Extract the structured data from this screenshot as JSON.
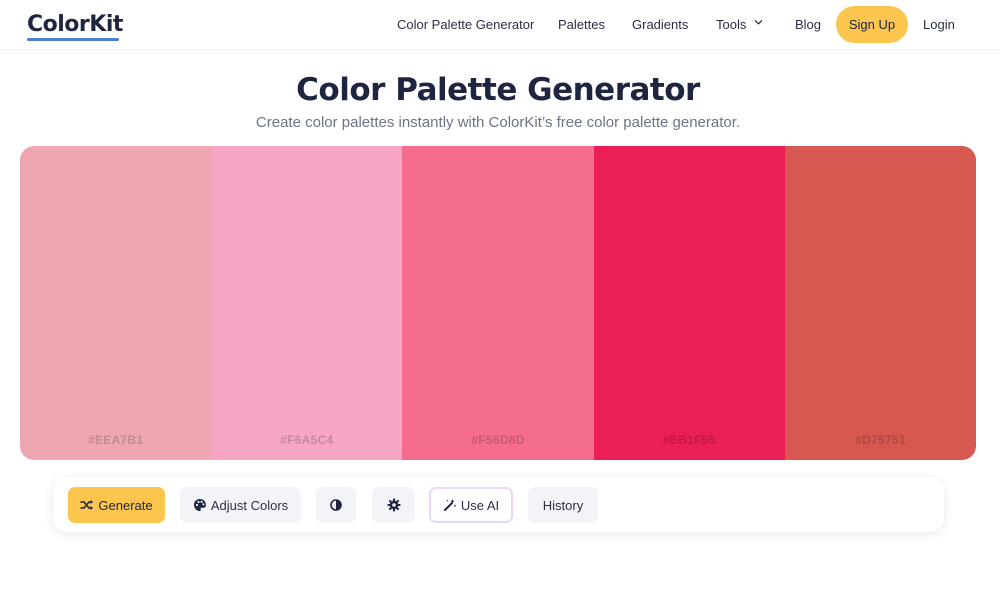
{
  "header": {
    "logo": "ColorKit",
    "nav": [
      {
        "label": "Color Palette Generator"
      },
      {
        "label": "Palettes"
      },
      {
        "label": "Gradients"
      },
      {
        "label": "Tools",
        "icon": "chevron-down-icon"
      },
      {
        "label": "Blog"
      }
    ],
    "signup_label": "Sign Up",
    "login_label": "Login"
  },
  "main": {
    "title": "Color Palette Generator",
    "subtitle": "Create color palettes instantly with ColorKit’s free color palette generator."
  },
  "palette": {
    "swatches": [
      {
        "hex": "#EEA7B1",
        "color": "#EEA7B1"
      },
      {
        "hex": "#F6A5C4",
        "color": "#F6A5C4"
      },
      {
        "hex": "#F56D8D",
        "color": "#F56D8D"
      },
      {
        "hex": "#EB1F55",
        "color": "#EB1F55"
      },
      {
        "hex": "#D75751",
        "color": "#D75751"
      }
    ]
  },
  "toolbar": {
    "generate_label": "Generate",
    "generate_icon": "shuffle-icon",
    "adjust_label": "Adjust Colors",
    "adjust_icon": "palette-icon",
    "contrast_icon": "contrast-icon",
    "settings_icon": "gear-icon",
    "ai_label": "Use AI",
    "ai_icon": "magic-wand-icon",
    "history_label": "History"
  },
  "colors": {
    "accent": "#FCC54E",
    "text_dark": "#1F2440",
    "logo_underline": "#4A7FD6",
    "ai_border": "#E6D7FB"
  }
}
